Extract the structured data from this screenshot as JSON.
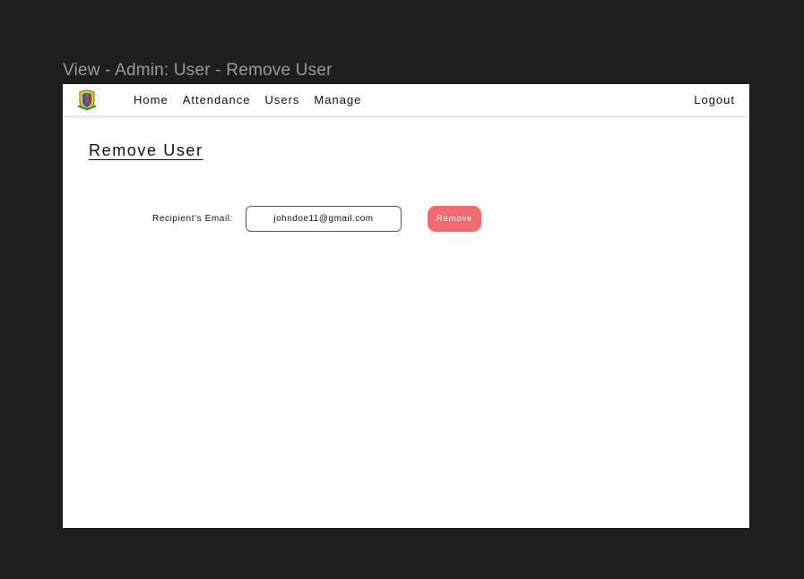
{
  "frame": {
    "title": "View - Admin: User - Remove User"
  },
  "navbar": {
    "logo_icon": "crest-logo-icon",
    "links": [
      {
        "label": "Home"
      },
      {
        "label": "Attendance"
      },
      {
        "label": "Users"
      },
      {
        "label": "Manage"
      }
    ],
    "logout_label": "Logout"
  },
  "page": {
    "title": "Remove User"
  },
  "form": {
    "email_label": "Recipient's Email:",
    "email_value": "johndoe11@gmail.com",
    "submit_label": "Remove",
    "submit_color": "#f06b6f"
  }
}
